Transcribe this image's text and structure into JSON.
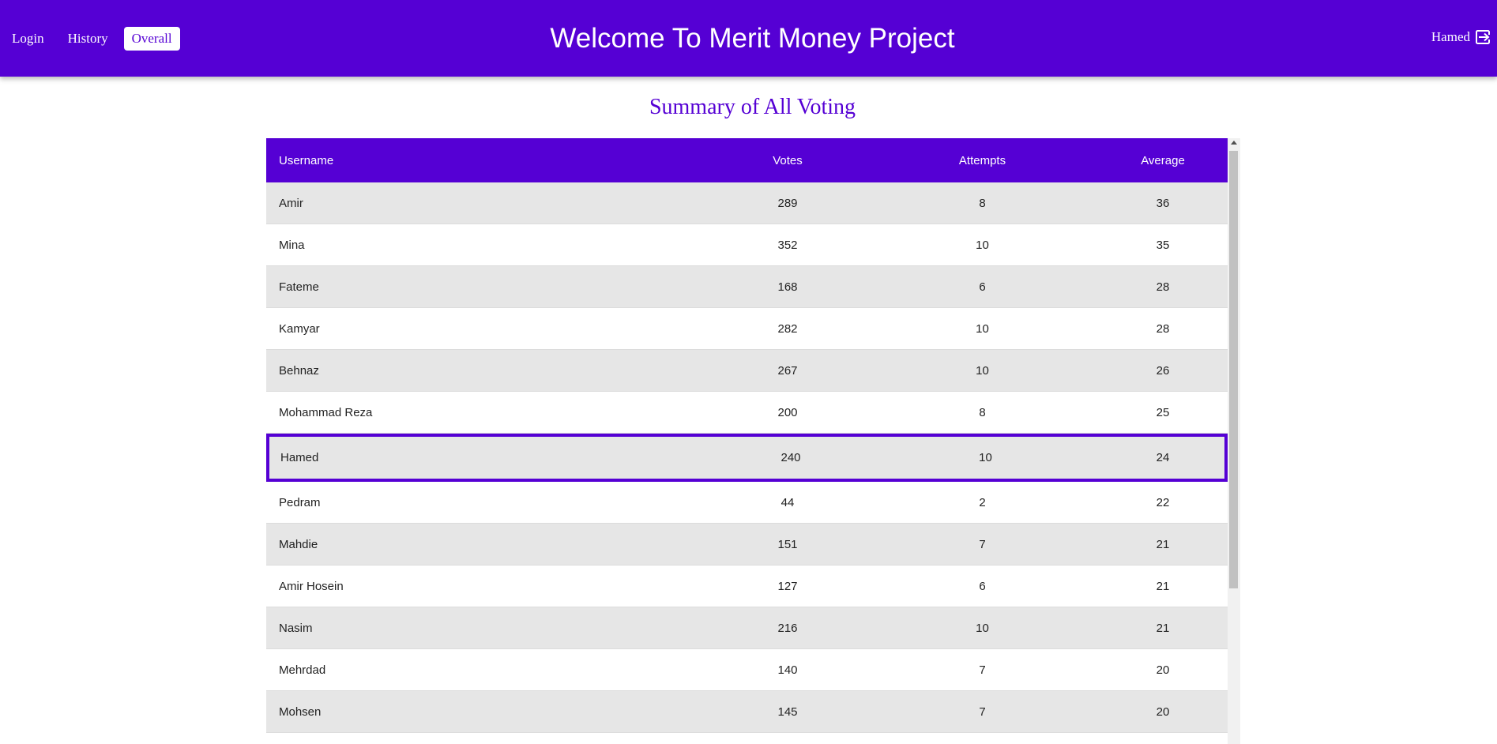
{
  "header": {
    "nav": [
      "Login",
      "History",
      "Overall"
    ],
    "active_nav": "Overall",
    "title": "Welcome To Merit Money Project",
    "user_name": "Hamed"
  },
  "summary": {
    "title": "Summary of All Voting",
    "columns": [
      "Username",
      "Votes",
      "Attempts",
      "Average"
    ],
    "selected_user": "Hamed",
    "rows": [
      {
        "username": "Amir",
        "votes": "289",
        "attempts": "8",
        "average": "36"
      },
      {
        "username": "Mina",
        "votes": "352",
        "attempts": "10",
        "average": "35"
      },
      {
        "username": "Fateme",
        "votes": "168",
        "attempts": "6",
        "average": "28"
      },
      {
        "username": "Kamyar",
        "votes": "282",
        "attempts": "10",
        "average": "28"
      },
      {
        "username": "Behnaz",
        "votes": "267",
        "attempts": "10",
        "average": "26"
      },
      {
        "username": "Mohammad Reza",
        "votes": "200",
        "attempts": "8",
        "average": "25"
      },
      {
        "username": "Hamed",
        "votes": "240",
        "attempts": "10",
        "average": "24"
      },
      {
        "username": "Pedram",
        "votes": "44",
        "attempts": "2",
        "average": "22"
      },
      {
        "username": "Mahdie",
        "votes": "151",
        "attempts": "7",
        "average": "21"
      },
      {
        "username": "Amir Hosein",
        "votes": "127",
        "attempts": "6",
        "average": "21"
      },
      {
        "username": "Nasim",
        "votes": "216",
        "attempts": "10",
        "average": "21"
      },
      {
        "username": "Mehrdad",
        "votes": "140",
        "attempts": "7",
        "average": "20"
      },
      {
        "username": "Mohsen",
        "votes": "145",
        "attempts": "7",
        "average": "20"
      },
      {
        "username": "",
        "votes": "",
        "attempts": "",
        "average": ""
      }
    ]
  },
  "colors": {
    "brand": "#5500d4",
    "row_alt": "#e6e6e6"
  }
}
